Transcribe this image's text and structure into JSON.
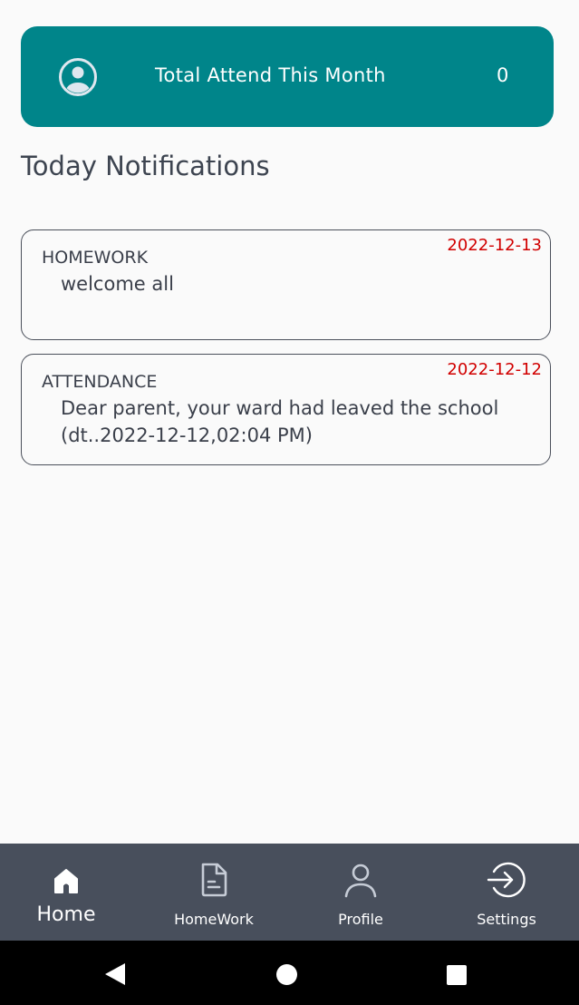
{
  "attendance_card": {
    "label": "Total Attend This Month",
    "count": "0"
  },
  "notifications": {
    "title": "Today Notifications",
    "items": [
      {
        "type": "HOMEWORK",
        "date": "2022-12-13",
        "message": "welcome all"
      },
      {
        "type": "ATTENDANCE",
        "date": "2022-12-12",
        "message": "Dear parent, your ward had leaved the school (dt..2022-12-12,02:04 PM)"
      }
    ]
  },
  "bottom_nav": {
    "items": [
      {
        "label": "Home",
        "icon": "home-icon",
        "active": true
      },
      {
        "label": "HomeWork",
        "icon": "document-icon",
        "active": false
      },
      {
        "label": "Profile",
        "icon": "person-icon",
        "active": false
      },
      {
        "label": "Settings",
        "icon": "logout-arrow-icon",
        "active": false
      }
    ]
  },
  "system_nav": {
    "icons": [
      "back-icon",
      "home-circle-icon",
      "recents-icon"
    ]
  },
  "colors": {
    "accent": "#00858a",
    "nav_background": "#484f5c",
    "date_red": "#d10000",
    "background": "#fafafa"
  }
}
